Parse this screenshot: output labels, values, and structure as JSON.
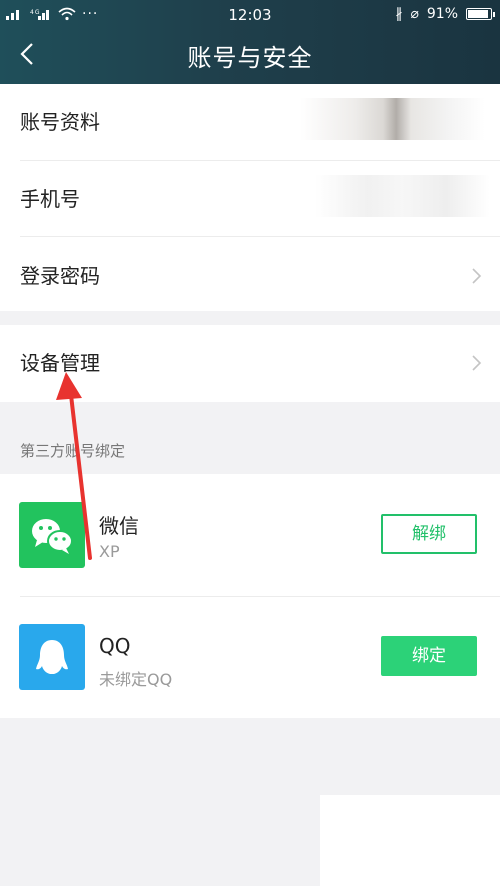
{
  "status_bar": {
    "signal_left": "ᴳᴵᴸ ´⁴ᴳᴵᴸ",
    "time": "12:03",
    "battery": "91%"
  },
  "header": {
    "title": "账号与安全"
  },
  "items": {
    "account_info": "账号资料",
    "phone": "手机号",
    "login_password": "登录密码",
    "device_manage": "设备管理"
  },
  "third_party": {
    "section_label": "第三方账号绑定",
    "wechat": {
      "name": "微信",
      "sub": "XP",
      "button": "解绑"
    },
    "qq": {
      "name": "QQ",
      "sub": "未绑定QQ",
      "button": "绑定"
    }
  },
  "colors": {
    "accent": "#22c06a",
    "header": "#1f3f4b",
    "annotation": "#e8332f"
  }
}
